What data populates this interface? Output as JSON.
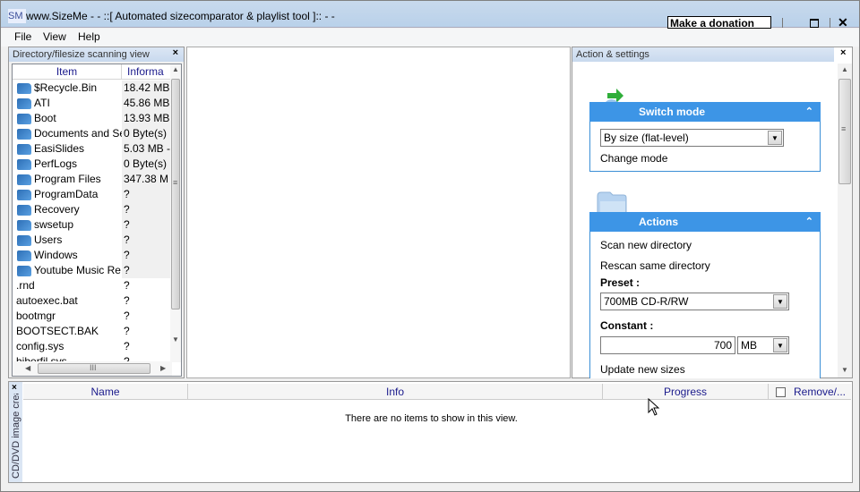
{
  "window": {
    "icon_text": "SM",
    "title": "www.SizeMe - - ::[ Automated sizecomparator & playlist tool ]:: - -",
    "donate_label": "Make a donation",
    "close_glyph": "✕"
  },
  "menu": {
    "items": [
      {
        "label": "File"
      },
      {
        "label": "View"
      },
      {
        "label": "Help"
      }
    ]
  },
  "directory_panel": {
    "caption": "Directory/filesize scanning view",
    "close_glyph": "×",
    "columns": [
      "Item",
      "Informa"
    ],
    "rows": [
      {
        "type": "folder",
        "name": "$Recycle.Bin",
        "info": "18.42 MB"
      },
      {
        "type": "folder",
        "name": "ATI",
        "info": "45.86 MB"
      },
      {
        "type": "folder",
        "name": "Boot",
        "info": "13.93 MB"
      },
      {
        "type": "folder",
        "name": "Documents and Se",
        "info": "0 Byte(s)"
      },
      {
        "type": "folder",
        "name": "EasiSlides",
        "info": "5.03 MB -"
      },
      {
        "type": "folder",
        "name": "PerfLogs",
        "info": "0 Byte(s)"
      },
      {
        "type": "folder",
        "name": "Program Files",
        "info": "347.38 M"
      },
      {
        "type": "folder",
        "name": "ProgramData",
        "info": "?"
      },
      {
        "type": "folder",
        "name": "Recovery",
        "info": "?"
      },
      {
        "type": "folder",
        "name": "swsetup",
        "info": "?"
      },
      {
        "type": "folder",
        "name": "Users",
        "info": "?"
      },
      {
        "type": "folder",
        "name": "Windows",
        "info": "?"
      },
      {
        "type": "folder",
        "name": "Youtube Music Re",
        "info": "?"
      },
      {
        "type": "file",
        "name": ".rnd",
        "info": "?"
      },
      {
        "type": "file",
        "name": "autoexec.bat",
        "info": "?"
      },
      {
        "type": "file",
        "name": "bootmgr",
        "info": "?"
      },
      {
        "type": "file",
        "name": "BOOTSECT.BAK",
        "info": "?"
      },
      {
        "type": "file",
        "name": "config.sys",
        "info": "?"
      },
      {
        "type": "file",
        "name": "hiberfil.sys",
        "info": "?"
      }
    ]
  },
  "settings_panel": {
    "caption": "Action & settings",
    "close_glyph": "×",
    "switch_mode": {
      "title": "Switch mode",
      "mode_value": "By size (flat-level)",
      "change_mode_label": "Change mode"
    },
    "actions": {
      "title": "Actions",
      "scan_new_label": "Scan new directory",
      "rescan_label": "Rescan same directory",
      "preset_label": "Preset :",
      "preset_value": "700MB CD-R/RW",
      "constant_label": "Constant :",
      "constant_value": "700",
      "unit_value": "MB",
      "update_label": "Update new sizes"
    },
    "collapse_glyph": "⌃"
  },
  "burn_panel": {
    "side_label": "CD/DVD image creator",
    "close_glyph": "×",
    "columns": [
      "Name",
      "Info",
      "Progress",
      "Remove/..."
    ],
    "remove_checked": false,
    "empty_message": "There are no items to show in this view."
  }
}
